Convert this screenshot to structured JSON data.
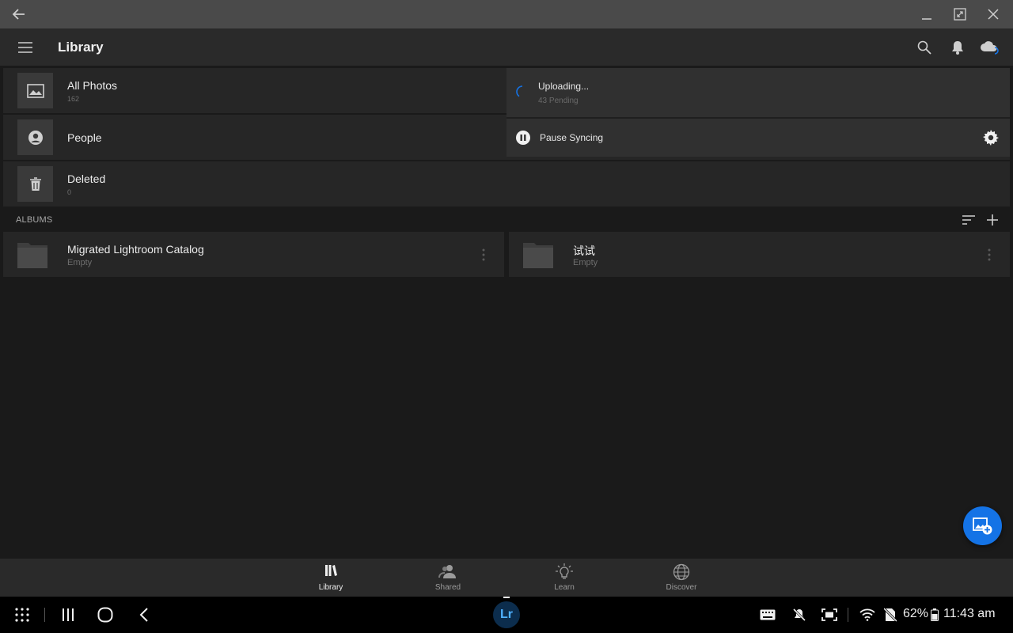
{
  "header": {
    "title": "Library"
  },
  "library_rows": [
    {
      "name": "All Photos",
      "count": "162",
      "icon": "image-icon"
    },
    {
      "name": "People",
      "count": "",
      "icon": "person-icon"
    },
    {
      "name": "Deleted",
      "count": "0",
      "icon": "trash-icon"
    }
  ],
  "albums": {
    "header": "ALBUMS",
    "items": [
      {
        "name": "Migrated Lightroom Catalog",
        "status": "Empty"
      },
      {
        "name": "试试",
        "status": "Empty"
      }
    ]
  },
  "sync": {
    "title": "Uploading...",
    "pending": "43 Pending",
    "pause_label": "Pause Syncing"
  },
  "bottom_nav": [
    {
      "label": "Library",
      "icon": "library-icon",
      "active": true
    },
    {
      "label": "Shared",
      "icon": "shared-people-icon",
      "active": false
    },
    {
      "label": "Learn",
      "icon": "lightbulb-icon",
      "active": false
    },
    {
      "label": "Discover",
      "icon": "globe-icon",
      "active": false
    }
  ],
  "taskbar": {
    "app_label": "Lr",
    "battery": "62%",
    "time": "11:43 am"
  },
  "colors": {
    "accent": "#1473e6",
    "background": "#1a1a1a",
    "panel": "#262626"
  }
}
